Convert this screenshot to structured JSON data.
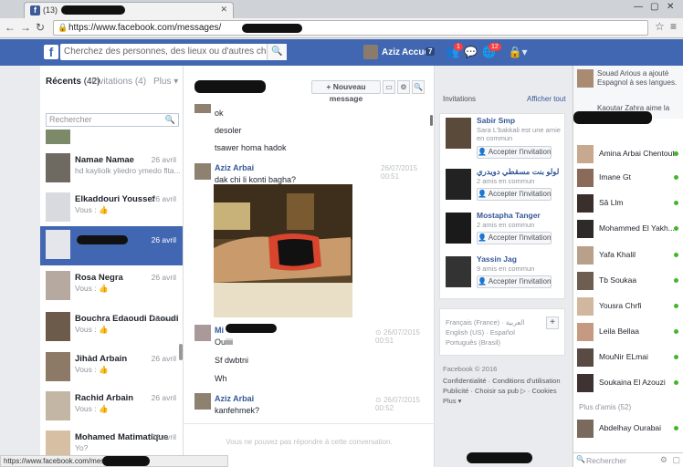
{
  "browser": {
    "tab_title": "(13)",
    "url": "https://www.facebook.com/messages/"
  },
  "fb": {
    "logo": "f",
    "search_placeholder": "Cherchez des personnes, des lieux ou d'autres choses",
    "user_name": "Aziz",
    "home_label": "Accueil",
    "home_count": "7",
    "friend_badge": "1",
    "notif_badge": "12"
  },
  "left": {
    "recents": "Récents",
    "recents_count": "(42)",
    "invitations": "Invitations",
    "invitations_count": "(4)",
    "more": "Plus",
    "search_placeholder": "Rechercher",
    "conversations": [
      {
        "name": "",
        "snippet": "",
        "date": ""
      },
      {
        "name": "Namae Namae",
        "snippet": "hd kayliolk yliedro ymedo flta...",
        "date": "26 avril"
      },
      {
        "name": "Elkaddouri Youssef",
        "snippet": "Vous :",
        "date": "26 avril"
      },
      {
        "name": "",
        "snippet": "",
        "date": "26 avril"
      },
      {
        "name": "Rosa Negra",
        "snippet": "Vous :",
        "date": "26 avril"
      },
      {
        "name": "Bouchra Edaoudi Daoudi",
        "snippet": "Vous :",
        "date": "26 avril"
      },
      {
        "name": "Jihàd Arbain",
        "snippet": "Vous :",
        "date": "26 avril"
      },
      {
        "name": "Rachid Arbain",
        "snippet": "Vous :",
        "date": "26 avril"
      },
      {
        "name": "Mohamed Matimatique",
        "snippet": "Yo?",
        "date": "26 avril"
      }
    ]
  },
  "middle": {
    "new_message": "+ Nouveau message",
    "messages": [
      {
        "text": "ok"
      },
      {
        "text": "desoler"
      },
      {
        "text": "tsawer homa hadok"
      },
      {
        "name": "Aziz Arbai",
        "text": "dak chi li konti bagha?",
        "date": "26/07/2015 00:51"
      },
      {
        "name": "Mi",
        "text": "Ouiiii",
        "date": "26/07/2015 00:51"
      },
      {
        "text": "Sf dwbtni"
      },
      {
        "text": "Wh"
      },
      {
        "name": "Aziz Arbai",
        "text": "kanfehmek?",
        "date": "26/07/2015 00:52"
      }
    ],
    "reply_note": "Vous ne pouvez pas répondre à cette conversation."
  },
  "right": {
    "invitations_title": "Invitations",
    "show_all": "Afficher tout",
    "accept_label": "Accepter l'invitation",
    "invites": [
      {
        "name": "Sabir Smp",
        "sub": "Sara L'bakkali est une amie en commun"
      },
      {
        "name": "لولو بنت مسقطي دويدري",
        "sub": "2 amis en commun"
      },
      {
        "name": "Mostapha Tanger",
        "sub": "2 amis en commun"
      },
      {
        "name": "Yassin Jag",
        "sub": "9 amis en commun"
      }
    ],
    "languages": {
      "line1": "Français (France) · العربية",
      "line2": "English (US) · Español",
      "line3": "Português (Brasil)"
    },
    "footer": {
      "copyright": "Facebook © 2016",
      "links1": "Confidentialité · Conditions d'utilisation",
      "links2": "Publicité · Choisir sa pub ▷ · Cookies",
      "links3": "Plus ▾"
    }
  },
  "chat": {
    "feed1": "Souad Arious a ajouté Espagnol à ses langues.",
    "feed2": "Kaoutar Zahra aime la",
    "contacts": [
      {
        "name": "Amina Arbai Chentout",
        "online": true
      },
      {
        "name": "Imane Gt",
        "online": true
      },
      {
        "name": "Sâ Llm",
        "online": true
      },
      {
        "name": "Mohammed El Yakh...",
        "online": true
      },
      {
        "name": "Yafa Khalil",
        "online": true
      },
      {
        "name": "Tb Soukaa",
        "online": true
      },
      {
        "name": "Yousra Chrfi",
        "online": true
      },
      {
        "name": "Leila Bellaa",
        "online": true
      },
      {
        "name": "MouNir ELmai",
        "online": true
      },
      {
        "name": "Soukaina El Azouzi",
        "online": true
      }
    ],
    "more_friends": "Plus d'amis (52)",
    "more_contacts": [
      {
        "name": "Abdelhay Ourabai",
        "online": true
      }
    ],
    "search_placeholder": "Rechercher"
  },
  "statusbar": "https://www.facebook.com/messages/"
}
